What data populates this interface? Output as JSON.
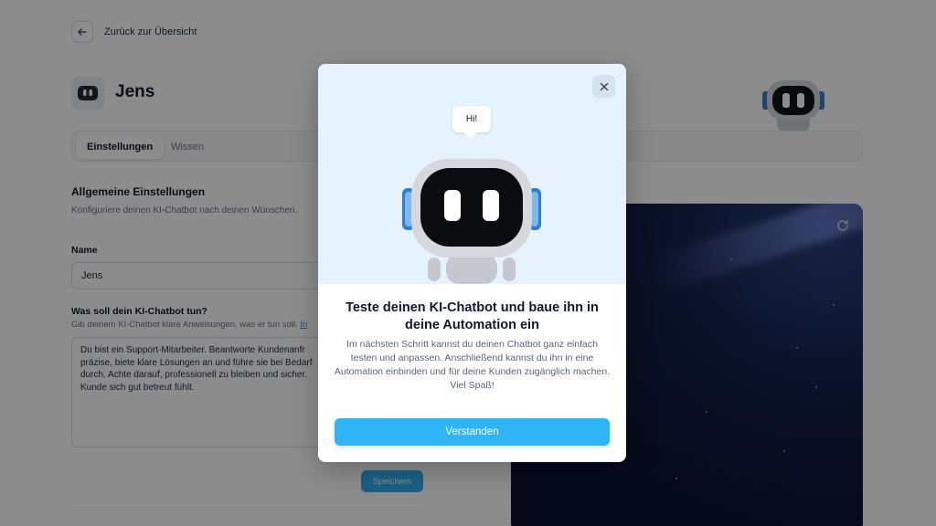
{
  "nav": {
    "back_label": "Zurück zur Übersicht"
  },
  "bot": {
    "name": "Jens"
  },
  "tabs": [
    {
      "label": "Einstellungen",
      "active": true
    },
    {
      "label": "Wissen",
      "active": false
    }
  ],
  "general": {
    "title": "Allgemeine Einstellungen",
    "subtitle": "Konfiguriere deinen KI-Chatbot nach deinen Wünschen."
  },
  "name_field": {
    "label": "Name",
    "value": "Jens"
  },
  "instructions": {
    "label": "Was soll dein KI-Chatbot tun?",
    "hint": "Gib deinem KI-Chatbot klare Anweisungen, was er tun soll.",
    "hint_link": "In",
    "lines": [
      "Du bist ein Support-Mitarbeiter. Beantworte Kundenanfr",
      "präzise, biete klare Lösungen an und führe sie bei Bedarf",
      "durch. Achte darauf, professionell zu bleiben und sicher.",
      "Kunde sich gut betreut fühlt."
    ]
  },
  "save_label": "Speichern",
  "modal": {
    "bubble": "Hi!",
    "title": "Teste deinen KI-Chatbot und baue ihn in deine Automation ein",
    "text": "Im nächsten Schritt kannst du deinen Chatbot ganz einfach testen und anpassen. Anschließend kannst du ihn in eine Automation einbinden und für deine Kunden zugänglich machen. Viel Spaß!",
    "button": "Verstanden"
  },
  "colors": {
    "accent": "#2fb5f5",
    "hero_bg": "#e6f3fc",
    "preview_bg": "#0a1230"
  },
  "icons": [
    "arrow-left-icon",
    "robot-icon",
    "close-icon",
    "refresh-icon"
  ]
}
